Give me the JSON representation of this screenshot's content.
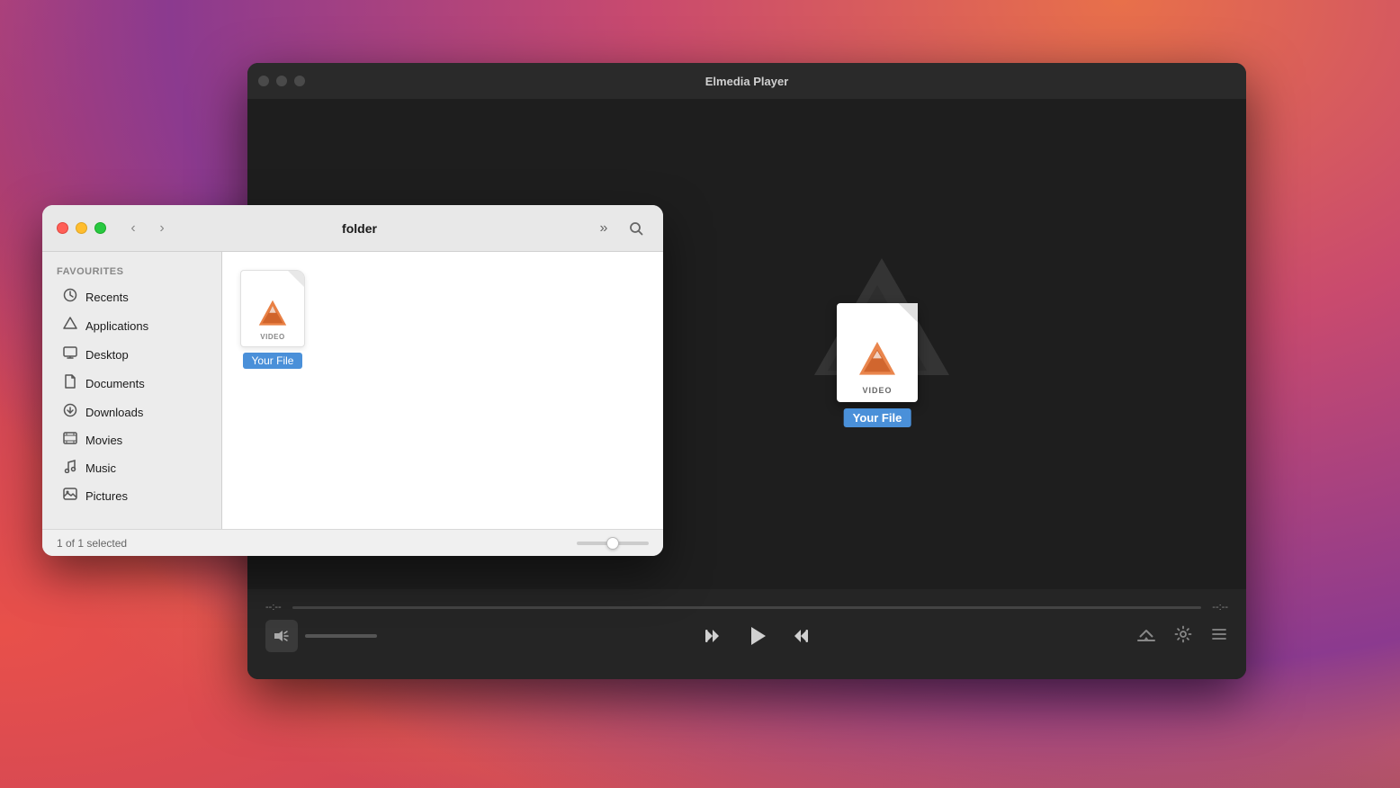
{
  "background": {
    "colors": [
      "#c94a6e",
      "#8b3a9f",
      "#e8704a"
    ]
  },
  "player_window": {
    "title": "Elmedia Player",
    "traffic_lights": [
      "close",
      "minimize",
      "maximize"
    ],
    "file_icon": {
      "label": "VIDEO",
      "name": "Your File"
    },
    "controls": {
      "time_start": "--:--",
      "time_end": "--:--",
      "buttons": {
        "skip_back": "⏮",
        "play": "▶",
        "skip_forward": "⏭",
        "airplay": "📡",
        "settings": "⚙",
        "playlist": "☰"
      }
    }
  },
  "finder_window": {
    "title": "folder",
    "traffic_lights": {
      "close": "#ff5f57",
      "minimize": "#ffbd2e",
      "maximize": "#28c840"
    },
    "sidebar": {
      "section_title": "Favourites",
      "items": [
        {
          "icon": "⊙",
          "label": "Recents"
        },
        {
          "icon": "✦",
          "label": "Applications"
        },
        {
          "icon": "▭",
          "label": "Desktop"
        },
        {
          "icon": "◻",
          "label": "Documents"
        },
        {
          "icon": "⊙",
          "label": "Downloads"
        },
        {
          "icon": "▦",
          "label": "Movies"
        },
        {
          "icon": "♪",
          "label": "Music"
        },
        {
          "icon": "◫",
          "label": "Pictures"
        }
      ]
    },
    "file": {
      "label": "VIDEO",
      "name": "Your File"
    },
    "status": {
      "text": "1 of 1 selected"
    }
  }
}
